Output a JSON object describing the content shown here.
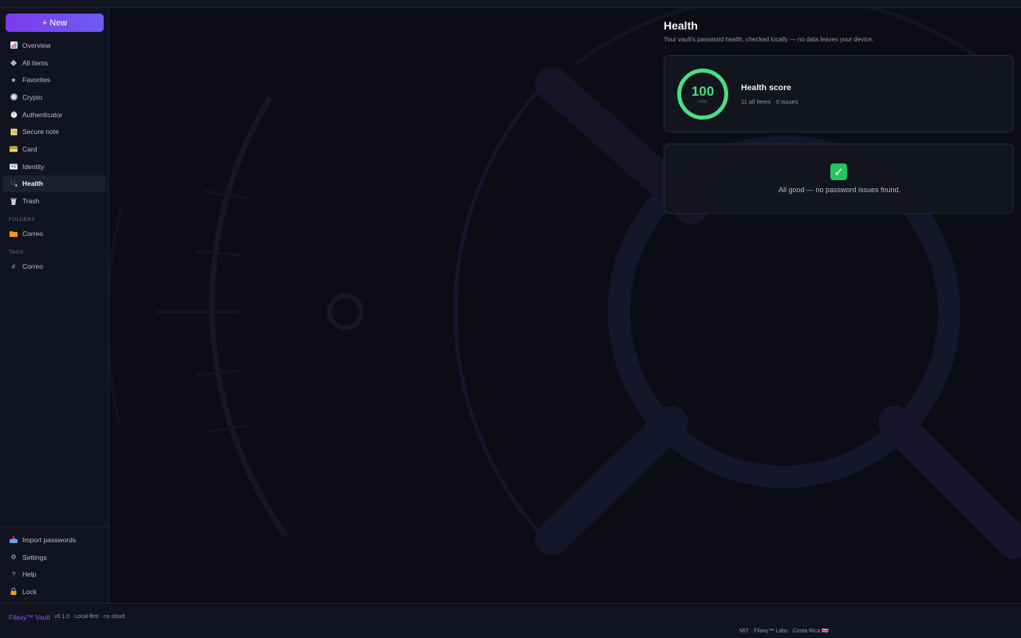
{
  "sidebar": {
    "new_label": "+ New",
    "items": [
      {
        "label": "Overview",
        "icon": "chart-icon"
      },
      {
        "label": "All items",
        "icon": "diamond-icon"
      },
      {
        "label": "Favorites",
        "icon": "star-icon"
      },
      {
        "label": "Crypto",
        "icon": "coin-icon"
      },
      {
        "label": "Authenticator",
        "icon": "stopwatch-icon"
      },
      {
        "label": "Secure note",
        "icon": "note-icon"
      },
      {
        "label": "Card",
        "icon": "credit-card-icon"
      },
      {
        "label": "Identity",
        "icon": "id-card-icon"
      },
      {
        "label": "Health",
        "icon": "stethoscope-icon",
        "active": true
      },
      {
        "label": "Trash",
        "icon": "trash-icon"
      }
    ],
    "folders_label": "FOLDERS",
    "folder": "Correo",
    "tags_label": "TAGS",
    "tag": "Correo",
    "bottom": [
      {
        "label": "Import passwords",
        "icon": "inbox-tray-icon"
      },
      {
        "label": "Settings",
        "icon": "gear-icon"
      },
      {
        "label": "Help",
        "icon": "question-icon"
      },
      {
        "label": "Lock",
        "icon": "lock-icon"
      }
    ]
  },
  "main": {
    "title": "Health",
    "subtitle": "Your vault's password health, checked locally — no data leaves your device.",
    "score": {
      "value": "100",
      "denominator": "/100",
      "title": "Health score",
      "meta": "11 all items · 0 issues",
      "fraction": 1.0
    },
    "empty": {
      "message": "All good — no password issues found."
    }
  },
  "footer": {
    "brand": "Filaxy™ Vault",
    "version": "v0.1.0 · Local-first · no cloud",
    "credits": "MIT · Filaxy™ Labs · Costa Rica 🇨🇷"
  },
  "colors": {
    "accent": "#7c3aed",
    "score_green": "#4ade80",
    "background": "#0c0d14",
    "panel": "#111320"
  }
}
